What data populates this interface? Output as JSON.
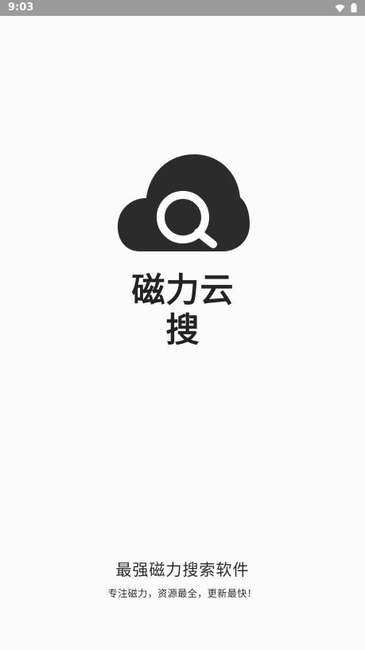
{
  "status_bar": {
    "time": "9:03",
    "icons": [
      "wifi-icon",
      "battery-icon"
    ]
  },
  "app": {
    "name": "磁力云搜",
    "logo_icon": "cloud-search-icon"
  },
  "splash": {
    "slogan": "最强磁力搜索软件",
    "subtitle": "专注磁力，资源最全，更新最快！"
  },
  "colors": {
    "status_bar": "#9b9b9b",
    "background": "#fbfbfb",
    "logo": "#2b2b2b",
    "text": "#2b2b2b"
  }
}
